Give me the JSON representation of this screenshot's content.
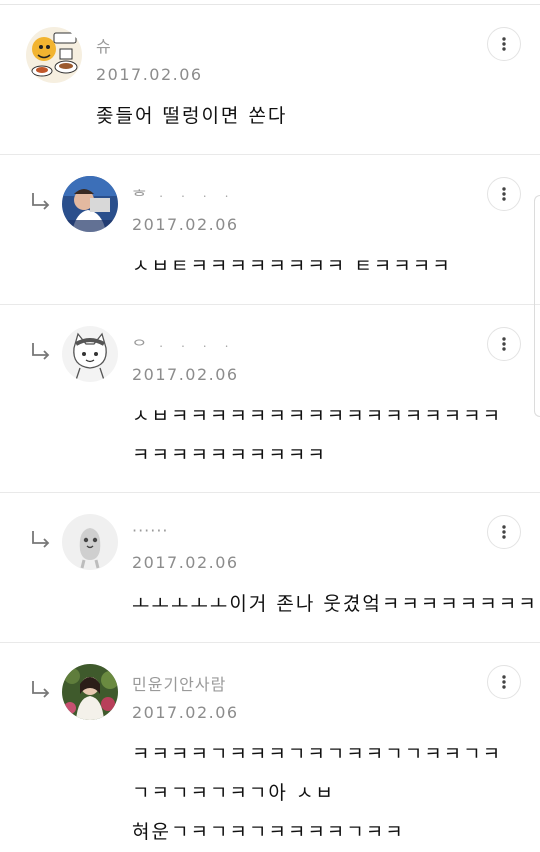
{
  "comments": [
    {
      "is_reply": false,
      "name": "슈",
      "date": "2017.02.06",
      "lines": [
        "좆들어 떨렁이면 쏜다"
      ],
      "avatar_icon": "cartoon-food-avatar-icon"
    },
    {
      "is_reply": true,
      "name": "ᄒ ᆞ ᆞ ᆞ ᆞ",
      "date": "2017.02.06",
      "lines": [
        "ㅅㅂㅌㅋㅋㅋㅋㅋㅋㅋㅋ ㅌㅋㅋㅋㅋ"
      ],
      "avatar_icon": "photo-avatar-icon"
    },
    {
      "is_reply": true,
      "name": "ᄋ ᆞ ᆞ ᆞ ᆞ",
      "date": "2017.02.06",
      "lines": [
        "ㅅㅂㅋㅋㅋㅋㅋㅋㅋㅋㅋㅋㅋㅋㅋㅋㅋㅋㅋ",
        "ㅋㅋㅋㅋㅋㅋㅋㅋㅋㅋ"
      ],
      "avatar_icon": "cat-avatar-icon"
    },
    {
      "is_reply": true,
      "name": "······",
      "date": "2017.02.06",
      "lines": [
        "ㅗㅗㅗㅗㅗ이거 존나 웃겼엌ㅋㅋㅋㅋㅋㅋㅋㅋ"
      ],
      "avatar_icon": "default-character-avatar-icon"
    },
    {
      "is_reply": true,
      "name": "민윤기안사람",
      "date": "2017.02.06",
      "lines": [
        "ㅋㅋㅋㅋㄱㅋㅋㅋㄱㅋㄱㅋㅋㄱㄱㅋㅋㄱㅋ",
        "ㄱㅋㄱㅋㄱㅋㄱ아 ㅅㅂ",
        "혀운ㄱㅋㄱㅋㄱㅋㅋㅋㅋㄱㅋㅋ"
      ],
      "avatar_icon": "person-photo-avatar-icon"
    }
  ],
  "colors": {
    "name_text": "#9a9a9a",
    "date_text": "#8c8c8c",
    "body_text": "#111111",
    "divider": "#e9e9e9"
  },
  "icons": {
    "more": "more-vertical-icon",
    "reply": "reply-arrow-icon"
  }
}
